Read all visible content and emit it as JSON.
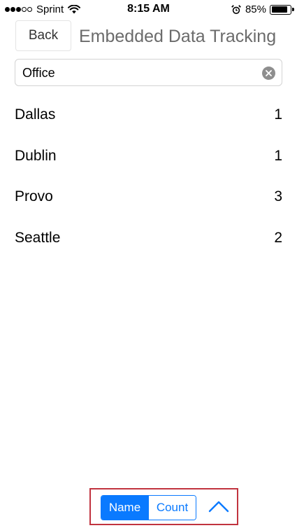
{
  "status_bar": {
    "carrier": "Sprint",
    "time": "8:15 AM",
    "battery_percent": "85%",
    "battery_level": 0.85,
    "signal_bars_filled": 3,
    "signal_bars_total": 5,
    "icons": [
      "wifi-icon",
      "alarm-clock-icon",
      "battery-icon"
    ]
  },
  "header": {
    "back_label": "Back",
    "title": "Embedded Data Tracking"
  },
  "search": {
    "value": "Office",
    "clear_icon": "clear-icon"
  },
  "list": {
    "items": [
      {
        "name": "Dallas",
        "count": "1"
      },
      {
        "name": "Dublin",
        "count": "1"
      },
      {
        "name": "Provo",
        "count": "3"
      },
      {
        "name": "Seattle",
        "count": "2"
      }
    ]
  },
  "toolbar": {
    "sort_options": [
      {
        "label": "Name",
        "selected": true
      },
      {
        "label": "Count",
        "selected": false
      }
    ],
    "scroll_icon": "chevron-up-icon",
    "accent_color": "#0a7aff",
    "highlight_color": "#c1333f"
  }
}
